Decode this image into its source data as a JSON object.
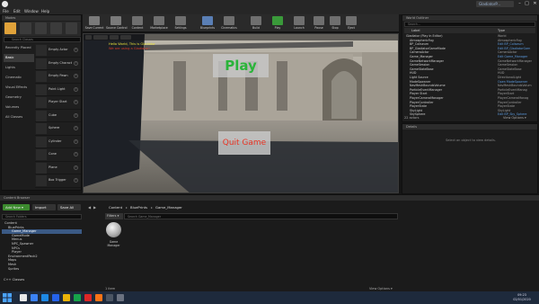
{
  "window": {
    "menu": [
      "File",
      "Edit",
      "Window",
      "Help"
    ],
    "project_name": "GladiatorP...",
    "controls": [
      "–",
      "□",
      "✕"
    ]
  },
  "modes": {
    "tab_title": "Modes",
    "search_placeholder": "Search Classes",
    "categories": [
      "Recently Placed",
      "Basic",
      "Lights",
      "Cinematic",
      "Visual Effects",
      "Geometry",
      "Volumes",
      "All Classes"
    ],
    "active_category": "Basic",
    "items": [
      "Empty Actor",
      "Empty Charact",
      "Empty Pawn",
      "Point Light",
      "Player Start",
      "Cube",
      "Sphere",
      "Cylinder",
      "Cone",
      "Plane",
      "Box Trigger"
    ]
  },
  "toolbar": {
    "buttons": [
      "Save Current",
      "Source Control",
      "Content",
      "Marketplace",
      "Settings",
      "Blueprints",
      "Cinematics",
      "Build",
      "Play",
      "Launch",
      "Pause",
      "Stop",
      "Eject"
    ]
  },
  "viewport": {
    "debug_line1": "Hello World, This is Gladiator",
    "debug_line2": "We are using a Gladiator!",
    "play_label": "Play",
    "quit_label": "Quit Game"
  },
  "outliner": {
    "tab_title": "World Outliner",
    "search_placeholder": "Search...",
    "col_label": "Label",
    "col_type": "Type",
    "rows": [
      {
        "label": "Gladiator (Play In Editor)",
        "type": "World",
        "link": false,
        "sel": false
      },
      {
        "label": "AtmosphericFog",
        "type": "AtmosphericFog",
        "link": false,
        "sel": false
      },
      {
        "label": "BP_Coliseum",
        "type": "Edit BP_Coliseum",
        "link": true,
        "sel": false
      },
      {
        "label": "BP_GladiatorGameMode",
        "type": "Edit BP_GladiatorGam",
        "link": true,
        "sel": false
      },
      {
        "label": "CameraActor",
        "type": "CameraActor",
        "link": false,
        "sel": false
      },
      {
        "label": "Game_Manager",
        "type": "Edit Game_Manager",
        "link": true,
        "sel": false
      },
      {
        "label": "GameNetworkManager",
        "type": "GameNetworkManager",
        "link": false,
        "sel": false
      },
      {
        "label": "GameSession",
        "type": "GameSession",
        "link": false,
        "sel": false
      },
      {
        "label": "GameStateBase",
        "type": "GameStateBase",
        "link": false,
        "sel": false
      },
      {
        "label": "HUD",
        "type": "HUD",
        "link": false,
        "sel": false
      },
      {
        "label": "Light Source",
        "type": "DirectionalLight",
        "link": false,
        "sel": false
      },
      {
        "label": "ModeSpawner",
        "type": "Open ModeSpawner",
        "link": true,
        "sel": false
      },
      {
        "label": "NavMeshBoundsVolume",
        "type": "NavMeshBoundsVolum",
        "link": false,
        "sel": false
      },
      {
        "label": "ParticleEventManager",
        "type": "ParticleEventManag",
        "link": false,
        "sel": false
      },
      {
        "label": "Player Start",
        "type": "PlayerStart",
        "link": false,
        "sel": false
      },
      {
        "label": "PlayerCameraManager",
        "type": "PlayerCameraManag",
        "link": false,
        "sel": false
      },
      {
        "label": "PlayerController",
        "type": "PlayerController",
        "link": false,
        "sel": false
      },
      {
        "label": "PlayerState",
        "type": "PlayerState",
        "link": false,
        "sel": false
      },
      {
        "label": "SkyLight",
        "type": "SkyLight",
        "link": false,
        "sel": false
      },
      {
        "label": "SkySphere",
        "type": "Edit BP_Sky_Sphere",
        "link": true,
        "sel": false
      }
    ],
    "actor_count": "22 actors",
    "view_options": "View Options ▾"
  },
  "details": {
    "tab_title": "Details",
    "hint": "Select an object to view details."
  },
  "content_browser": {
    "tab_title": "Content Browser",
    "add_new": "Add New ▾",
    "import": "Import",
    "save_all": "Save All",
    "path": [
      "Content",
      "BluePrints",
      "Game_Manager"
    ],
    "folder_search_placeholder": "Search Folders",
    "filters": "Filters ▾",
    "asset_search_placeholder": "Search Game_Manager",
    "tree": [
      {
        "label": "Content",
        "indent": 0,
        "sel": false
      },
      {
        "label": "BluePrints",
        "indent": 1,
        "sel": false
      },
      {
        "label": "Game_Manager",
        "indent": 2,
        "sel": true
      },
      {
        "label": "GameMode",
        "indent": 2,
        "sel": false
      },
      {
        "label": "Menus",
        "indent": 2,
        "sel": false
      },
      {
        "label": "NPC_Spawner",
        "indent": 2,
        "sel": false
      },
      {
        "label": "NPCs",
        "indent": 2,
        "sel": false
      },
      {
        "label": "Player",
        "indent": 2,
        "sel": false
      },
      {
        "label": "EnvironmentPack2",
        "indent": 1,
        "sel": false
      },
      {
        "label": "Maps",
        "indent": 1,
        "sel": false
      },
      {
        "label": "Mesh",
        "indent": 1,
        "sel": false
      },
      {
        "label": "Sprites",
        "indent": 1,
        "sel": false
      }
    ],
    "cpp_classes": "C++ Classes",
    "asset_name": "Game Manager",
    "item_count": "1 item",
    "view_options": "View Options ▾"
  },
  "taskbar": {
    "time": "09:23",
    "date": "02/01/2020",
    "icon_colors": [
      "#e8e8e8",
      "#3b82f6",
      "#1e88e5",
      "#2563eb",
      "#eab308",
      "#16a34a",
      "#dc2626",
      "#f97316",
      "#4b5563",
      "#6b7280"
    ]
  }
}
